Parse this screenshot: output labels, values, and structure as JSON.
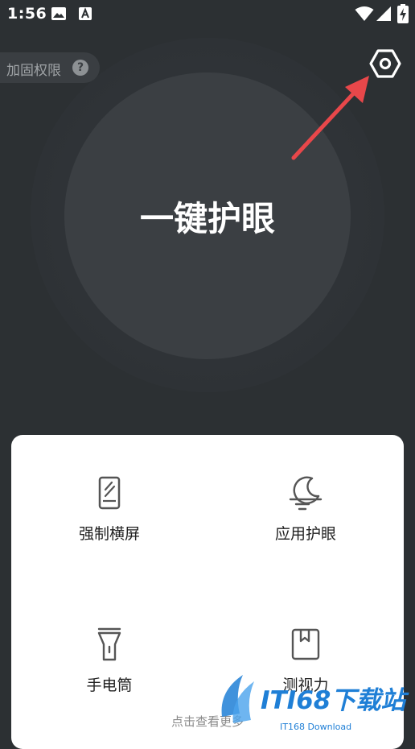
{
  "status_bar": {
    "time": "1:56",
    "icons": [
      "image-icon",
      "text-a-icon",
      "wifi-icon",
      "signal-icon",
      "battery-charging-icon"
    ]
  },
  "permission": {
    "label": "加固权限",
    "help_symbol": "?"
  },
  "settings": {
    "icon": "hexagon-settings-icon"
  },
  "main": {
    "button_label": "一键护眼"
  },
  "features": [
    {
      "icon": "rotate-phone-icon",
      "label": "强制横屏"
    },
    {
      "icon": "moon-lines-icon",
      "label": "应用护眼"
    },
    {
      "icon": "flashlight-icon",
      "label": "手电筒"
    },
    {
      "icon": "bookmark-book-icon",
      "label": "测视力"
    }
  ],
  "more": {
    "label": "点击查看更多"
  },
  "watermark": {
    "brand": "ITI68下载站",
    "sub": "IT168 Download"
  },
  "colors": {
    "background": "#2c3033",
    "circle": "#3b3f43",
    "card": "#ffffff",
    "arrow": "#e8474a",
    "watermark": "#1f7fd6"
  }
}
